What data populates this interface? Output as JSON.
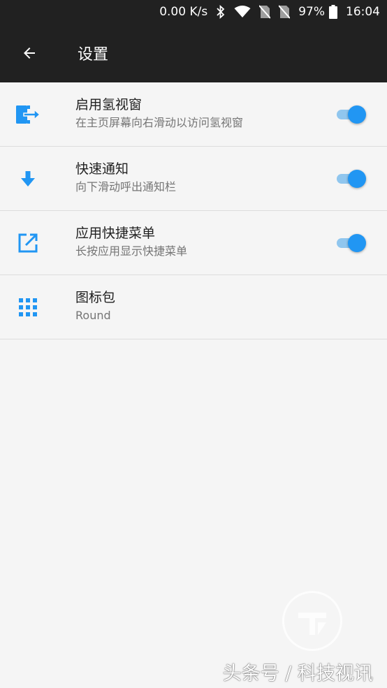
{
  "status_bar": {
    "speed": "0.00 K/s",
    "battery": "97%",
    "time": "16:04"
  },
  "app_bar": {
    "title": "设置"
  },
  "settings": [
    {
      "title": "启用氢视窗",
      "subtitle": "在主页屏幕向右滑动以访问氢视窗",
      "icon": "exit-to-app-icon",
      "enabled": true
    },
    {
      "title": "快速通知",
      "subtitle": "向下滑动呼出通知栏",
      "icon": "arrow-down-icon",
      "enabled": true
    },
    {
      "title": "应用快捷菜单",
      "subtitle": "长按应用显示快捷菜单",
      "icon": "open-in-new-icon",
      "enabled": true
    },
    {
      "title": "图标包",
      "subtitle": "Round",
      "icon": "apps-grid-icon"
    }
  ],
  "watermark": {
    "text": "头条号 / 科技视讯"
  },
  "colors": {
    "accent": "#2196f3",
    "toolbar": "#212121",
    "background": "#f5f5f5"
  }
}
